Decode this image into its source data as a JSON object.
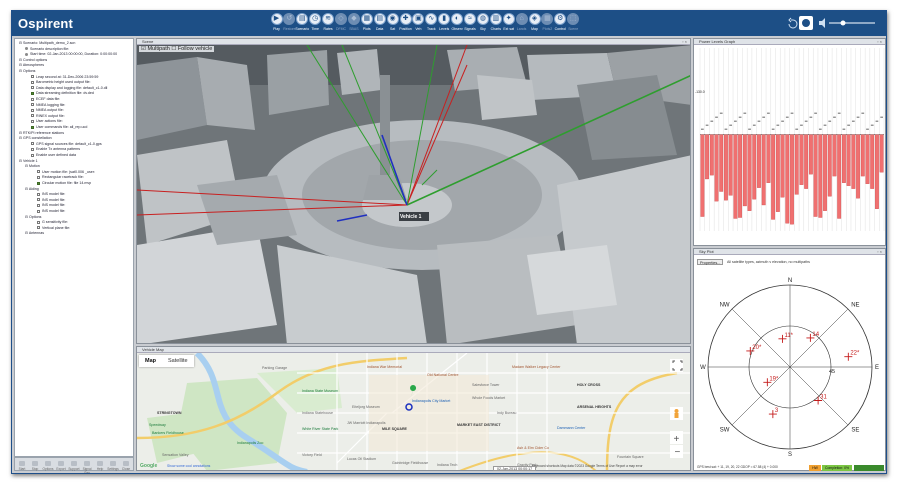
{
  "app": {
    "logo_text": "Ospirent",
    "toolbar": [
      "Play",
      "Restore",
      "Scenario",
      "Time",
      "Rates",
      "DFMC",
      "SBAS",
      "Plots",
      "Data",
      "Sat",
      "Position",
      "Veh",
      "Track",
      "Levels",
      "Observ",
      "Signals",
      "Sky",
      "Charts",
      "Ext sat",
      "Lands",
      "Map",
      "Plots2",
      "Control",
      "Scene"
    ],
    "toolbar_enabled": [
      true,
      false,
      true,
      true,
      true,
      false,
      false,
      true,
      true,
      true,
      true,
      true,
      true,
      true,
      true,
      true,
      true,
      true,
      true,
      false,
      true,
      false,
      true,
      false
    ]
  },
  "tree": {
    "rows": [
      {
        "text": "Scenario: Multipath_demo_2.scn",
        "indent": 0,
        "type": "expand"
      },
      {
        "text": "Scenario description file:",
        "indent": 1,
        "type": "dot",
        "color": "#8a8a8a"
      },
      {
        "text": "Start time: 02-Jan-2013 00:00:00, Duration: 0:00:00:00",
        "indent": 1,
        "type": "dot",
        "color": "#8a8a8a"
      },
      {
        "text": "Control options",
        "indent": 0,
        "type": "expand"
      },
      {
        "text": "Atmospheres",
        "indent": 0,
        "type": "expand"
      },
      {
        "text": "Options",
        "indent": 0,
        "type": "expand"
      },
      {
        "text": "Leap second at: 31-Dec-2006 23:59:59",
        "indent": 2,
        "type": "cb"
      },
      {
        "text": "Barometric height used output file:",
        "indent": 2,
        "type": "cb"
      },
      {
        "text": "Data display and logging file: default_c1-0.dll",
        "indent": 2,
        "type": "cb"
      },
      {
        "text": "Data streaming definition file: dv.ded",
        "indent": 2,
        "type": "cbon"
      },
      {
        "text": "ECEF data file:",
        "indent": 2,
        "type": "cb"
      },
      {
        "text": "NMEA logging file:",
        "indent": 2,
        "type": "cb"
      },
      {
        "text": "NMEA output file:",
        "indent": 2,
        "type": "cb"
      },
      {
        "text": "RINEX output file:",
        "indent": 2,
        "type": "cb"
      },
      {
        "text": "User actions file:",
        "indent": 2,
        "type": "cb"
      },
      {
        "text": "User commands file: all_rep.ucd",
        "indent": 2,
        "type": "cbon"
      },
      {
        "text": "RTK/PI reference stations",
        "indent": 0,
        "type": "expand"
      },
      {
        "text": "GPS constellation",
        "indent": 0,
        "type": "expand"
      },
      {
        "text": "GPS signal sources file: default_c1-0.gps",
        "indent": 2,
        "type": "cb"
      },
      {
        "text": "Enable Tx antenna patterns",
        "indent": 2,
        "type": "cb"
      },
      {
        "text": "Enable user defined data",
        "indent": 2,
        "type": "cb"
      },
      {
        "text": "Vehicle 1",
        "indent": 0,
        "type": "expand"
      },
      {
        "text": "Motion",
        "indent": 1,
        "type": "expand"
      },
      {
        "text": "User motion file: (sat0.006 _user:",
        "indent": 3,
        "type": "cb"
      },
      {
        "text": "Rectangular racetrack file:",
        "indent": 3,
        "type": "cb"
      },
      {
        "text": "Circular motion file: file 14.mvp",
        "indent": 3,
        "type": "cbon"
      },
      {
        "text": "Aiding",
        "indent": 1,
        "type": "expand"
      },
      {
        "text": "INS model file:",
        "indent": 3,
        "type": "cb"
      },
      {
        "text": "INS model file:",
        "indent": 3,
        "type": "cb"
      },
      {
        "text": "INS model file:",
        "indent": 3,
        "type": "cb"
      },
      {
        "text": "INS model file:",
        "indent": 3,
        "type": "cb"
      },
      {
        "text": "Options",
        "indent": 1,
        "type": "expand"
      },
      {
        "text": "G sensitivity file:",
        "indent": 3,
        "type": "cb"
      },
      {
        "text": "Vertical plane file:",
        "indent": 3,
        "type": "cb"
      },
      {
        "text": "Antennas",
        "indent": 1,
        "type": "expand"
      }
    ],
    "footer": [
      "Start",
      "Stop",
      "Options",
      "Export",
      "Support",
      "Signal Gen",
      "Help",
      "Settings",
      "Close"
    ]
  },
  "scene": {
    "title": "Scene",
    "multipath_label": "Multipath",
    "follow_label": "Follow vehicle",
    "vehicle_label": "Vehicle 1"
  },
  "map": {
    "title": "Vehicle Map",
    "tab_map": "Map",
    "tab_satellite": "Satellite",
    "labels": [
      "Parking Garage",
      "Indiana War Memorial",
      "Old National Centre",
      "Madam Walker Legacy Center",
      "Indiana State Museum",
      "Eiteljorg Museum",
      "JW Marriott Indianapolis",
      "Indiana Statehouse",
      "White River State Park",
      "Indianapolis Zoo",
      "Victory Field",
      "Indianapolis City Market",
      "Whole Foods Market",
      "Salesforce Tower",
      "MILE SQUARE",
      "MARKET EAST DISTRICT",
      "ARSENAL HEIGHTS",
      "HOLY CROSS",
      "Lucas Oil Stadium",
      "Gainbridge Fieldhouse",
      "Ash & Elm Cider Co",
      "Dammann Center",
      "Fountain Square",
      "Bankers Fieldhouse",
      "Sensation Valley",
      "STRINGTOWN",
      "Speedway",
      "Indiana Tech",
      "Gravity Park",
      "Indy Bureau"
    ],
    "footer": "Keyboard shortcuts  Map data ©2023 Google  Terms of Use  Report a map error",
    "google": "Google",
    "bottom_link": "Show some cool annotations"
  },
  "power": {
    "title": "Power Levels Graph",
    "ref_label": "-130.0",
    "bars_db": [
      -138.5,
      -134.6,
      -134.2,
      -136.9,
      -135.9,
      -136.8,
      -136.3,
      -138.7,
      -138.6,
      -137.4,
      -137.9,
      -136.7,
      -135.5,
      -137.3,
      -135.0,
      -138.8,
      -138.0,
      -136.5,
      -139.2,
      -139.3,
      -136.2,
      -135.2,
      -135.6,
      -134.1,
      -138.5,
      -138.6,
      -137.9,
      -136.4,
      -134.3,
      -138.7,
      -135.0,
      -135.3,
      -135.6,
      -136.6,
      -134.3,
      -135.1,
      -135.6,
      -137.7,
      -133.9
    ],
    "ymin": -140.0,
    "ymax": -121.0
  },
  "sky": {
    "title": "Sky Plot",
    "button": "Properties...",
    "caption": "All satellite types, azimuth v elevation, no multipaths",
    "compass": [
      "N",
      "NE",
      "E",
      "SE",
      "S",
      "SW",
      "W",
      "NW"
    ],
    "ring_label": "45",
    "sats": [
      {
        "id": "20*",
        "az": 292,
        "el": 43
      },
      {
        "id": "11*",
        "az": 345,
        "el": 58
      },
      {
        "id": "14",
        "az": 35,
        "el": 51
      },
      {
        "id": "22*",
        "az": 80,
        "el": 25
      },
      {
        "id": "19*",
        "az": 236,
        "el": 60
      },
      {
        "id": "31",
        "az": 140,
        "el": 42
      },
      {
        "id": "3",
        "az": 200,
        "el": 35
      }
    ],
    "footer": "GPS best sat: + 11, 19, 20, 22 GDOP = 67.58 (4) + 0.000"
  },
  "status": {
    "clock": "02-Jan-2013 00:00:17",
    "chip1": "HW",
    "chip2": "Completion: 0%",
    "chip3": "Run"
  }
}
